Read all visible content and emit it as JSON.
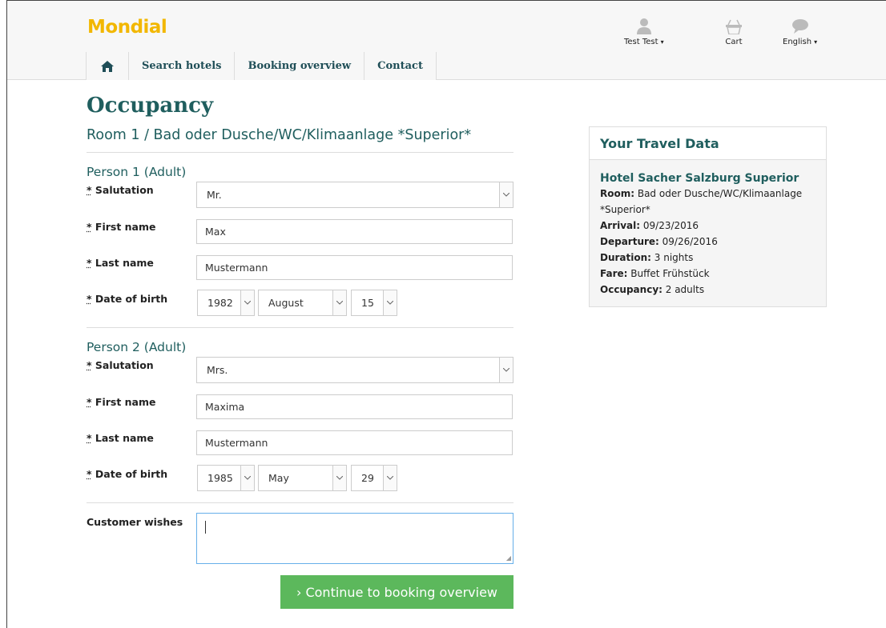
{
  "header": {
    "logo": "Mondial",
    "nav": [
      "Search hotels",
      "Booking overview",
      "Contact"
    ],
    "user": "Test Test",
    "cart": "Cart",
    "language": "English"
  },
  "page": {
    "title": "Occupancy",
    "room": "Room 1 / Bad oder Dusche/WC/Klimaanlage *Superior*"
  },
  "labels": {
    "salutation": "Salutation",
    "first_name": "First name",
    "last_name": "Last name",
    "dob": "Date of birth",
    "star": "*",
    "wishes": "Customer wishes"
  },
  "persons": [
    {
      "title": "Person 1 (Adult)",
      "salutation": "Mr.",
      "first_name": "Max",
      "last_name": "Mustermann",
      "year": "1982",
      "month": "August",
      "day": "15"
    },
    {
      "title": "Person 2 (Adult)",
      "salutation": "Mrs.",
      "first_name": "Maxima",
      "last_name": "Mustermann",
      "year": "1985",
      "month": "May",
      "day": "29"
    }
  ],
  "continue_button": "› Continue to booking overview",
  "travel": {
    "title": "Your Travel Data",
    "hotel": "Hotel Sacher Salzburg Superior",
    "room_label": "Room:",
    "room": " Bad oder Dusche/WC/Klimaanlage *Superior*",
    "arrival_label": "Arrival:",
    "arrival": " 09/23/2016",
    "departure_label": "Departure:",
    "departure": " 09/26/2016",
    "duration_label": "Duration:",
    "duration": " 3 nights",
    "fare_label": "Fare:",
    "fare": " Buffet Frühstück",
    "occupancy_label": "Occupancy:",
    "occupancy": " 2 adults"
  },
  "colors": {
    "accent": "#1f5e5e",
    "button": "#5cb85c",
    "logo": "#f2b700"
  }
}
